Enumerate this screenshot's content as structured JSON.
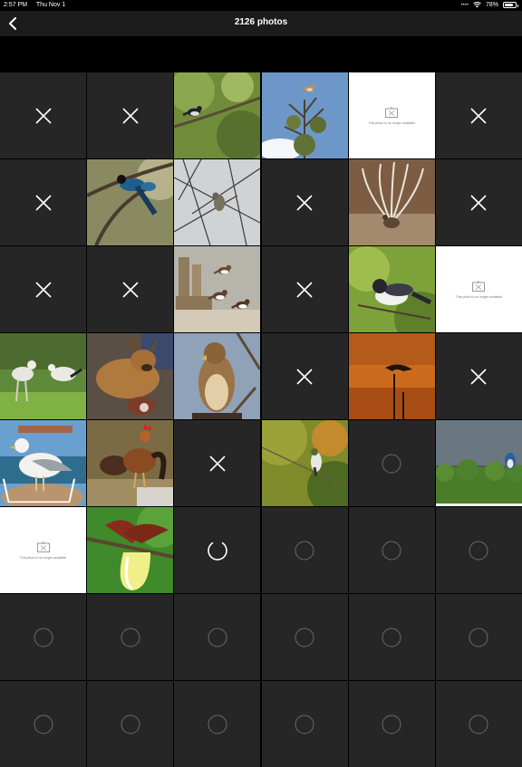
{
  "status_bar": {
    "time": "2:57 PM",
    "date": "Thu Nov 1",
    "battery": "78%",
    "battery_level": 0.78
  },
  "nav": {
    "title": "2126 photos",
    "back_icon": "chevron-left-icon"
  },
  "unavailable_text": "This photo is no longer available",
  "rows": [
    [
      {
        "type": "failed"
      },
      {
        "type": "failed"
      },
      {
        "type": "photo",
        "label": "bird-on-branch-photo"
      },
      {
        "type": "photo",
        "label": "bird-on-tree-sky-photo"
      },
      {
        "type": "unavailable"
      },
      {
        "type": "failed"
      }
    ],
    [
      {
        "type": "failed"
      },
      {
        "type": "photo",
        "label": "blue-bird-photo"
      },
      {
        "type": "photo",
        "label": "bird-bare-branches-photo"
      },
      {
        "type": "failed"
      },
      {
        "type": "photo",
        "label": "lyrebird-photo"
      },
      {
        "type": "failed"
      }
    ],
    [
      {
        "type": "failed"
      },
      {
        "type": "failed"
      },
      {
        "type": "photo",
        "label": "turnstones-photo"
      },
      {
        "type": "failed"
      },
      {
        "type": "photo",
        "label": "kingbird-photo"
      },
      {
        "type": "unavailable"
      }
    ],
    [
      {
        "type": "photo",
        "label": "secretary-birds-photo"
      },
      {
        "type": "photo",
        "label": "dog-photo"
      },
      {
        "type": "photo",
        "label": "hawk-photo"
      },
      {
        "type": "failed"
      },
      {
        "type": "photo",
        "label": "bird-silhouette-sunset-photo"
      },
      {
        "type": "failed"
      }
    ],
    [
      {
        "type": "photo",
        "label": "seagull-photo"
      },
      {
        "type": "photo",
        "label": "rooster-photo"
      },
      {
        "type": "failed"
      },
      {
        "type": "photo",
        "label": "hummingbird-photo"
      },
      {
        "type": "pending"
      },
      {
        "type": "photo",
        "label": "jay-on-hedge-photo"
      }
    ],
    [
      {
        "type": "unavailable"
      },
      {
        "type": "photo",
        "label": "bird-of-paradise-photo"
      },
      {
        "type": "loading"
      },
      {
        "type": "pending"
      },
      {
        "type": "pending"
      },
      {
        "type": "pending"
      }
    ],
    [
      {
        "type": "pending"
      },
      {
        "type": "pending"
      },
      {
        "type": "pending"
      },
      {
        "type": "pending"
      },
      {
        "type": "pending"
      },
      {
        "type": "pending"
      }
    ],
    [
      {
        "type": "pending"
      },
      {
        "type": "pending"
      },
      {
        "type": "pending"
      },
      {
        "type": "pending"
      },
      {
        "type": "pending"
      },
      {
        "type": "pending"
      }
    ]
  ]
}
